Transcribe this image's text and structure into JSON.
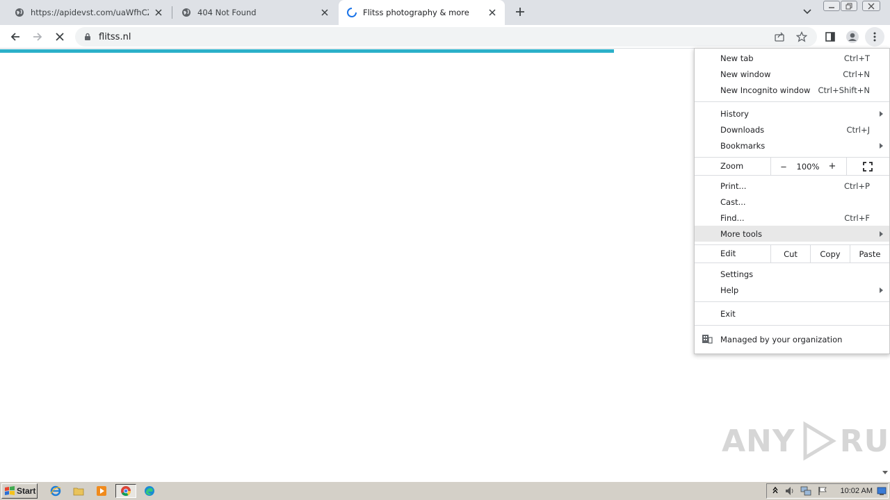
{
  "tabs": [
    {
      "title": "https://apidevst.com/uaWfhCZHOIP",
      "active": false
    },
    {
      "title": "404 Not Found",
      "active": false
    },
    {
      "title": "Flitss photography & more",
      "active": true
    }
  ],
  "toolbar": {
    "url": "flitss.nl"
  },
  "page_load_progress": 0.69,
  "menu": {
    "items": {
      "new_tab": {
        "label": "New tab",
        "shortcut": "Ctrl+T"
      },
      "new_window": {
        "label": "New window",
        "shortcut": "Ctrl+N"
      },
      "new_incognito": {
        "label": "New Incognito window",
        "shortcut": "Ctrl+Shift+N"
      },
      "history": {
        "label": "History"
      },
      "downloads": {
        "label": "Downloads",
        "shortcut": "Ctrl+J"
      },
      "bookmarks": {
        "label": "Bookmarks"
      },
      "print": {
        "label": "Print...",
        "shortcut": "Ctrl+P"
      },
      "cast": {
        "label": "Cast..."
      },
      "find": {
        "label": "Find...",
        "shortcut": "Ctrl+F"
      },
      "more_tools": {
        "label": "More tools"
      },
      "settings": {
        "label": "Settings"
      },
      "help": {
        "label": "Help"
      },
      "exit": {
        "label": "Exit"
      },
      "managed": {
        "label": "Managed by your organization"
      }
    },
    "zoom": {
      "label": "Zoom",
      "minus": "−",
      "value": "100%",
      "plus": "+"
    },
    "edit": {
      "label": "Edit",
      "cut": "Cut",
      "copy": "Copy",
      "paste": "Paste"
    },
    "highlighted": "More tools"
  },
  "watermark": {
    "left": "ANY",
    "right": "RUN"
  },
  "taskbar": {
    "start_label": "Start",
    "clock": "10:02 AM"
  },
  "colors": {
    "progress": "#2bb0c9",
    "tabstrip": "#dee1e6",
    "taskbar": "#d4d0c8"
  }
}
